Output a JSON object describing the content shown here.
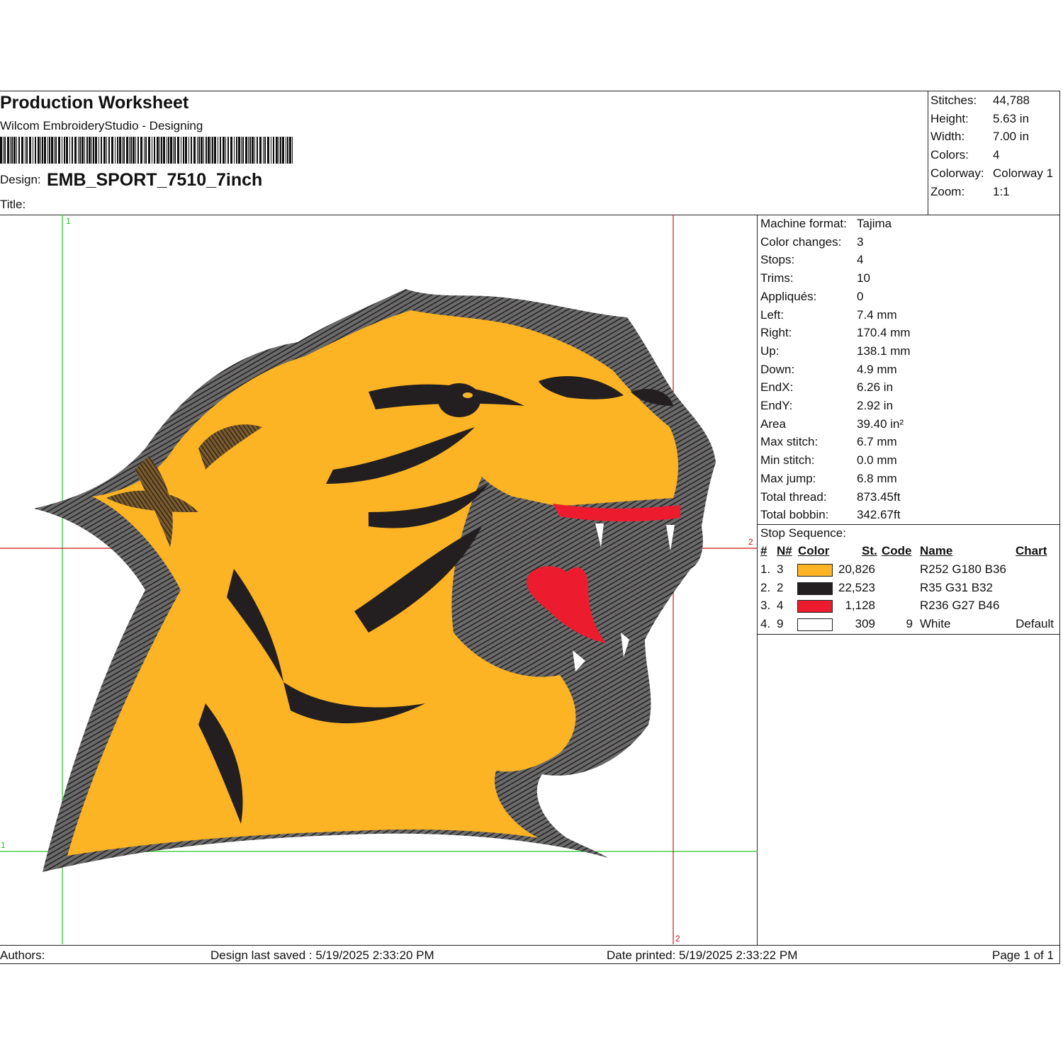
{
  "header": {
    "title": "Production Worksheet",
    "subtitle": "Wilcom EmbroideryStudio - Designing",
    "design_label": "Design:",
    "design_name": "EMB_SPORT_7510_7inch",
    "title_label": "Title:"
  },
  "summary": [
    {
      "label": "Stitches:",
      "value": "44,788"
    },
    {
      "label": "Height:",
      "value": "5.63 in"
    },
    {
      "label": "Width:",
      "value": "7.00 in"
    },
    {
      "label": "Colors:",
      "value": "4"
    },
    {
      "label": "Colorway:",
      "value": "Colorway 1"
    },
    {
      "label": "Zoom:",
      "value": "1:1"
    }
  ],
  "details": [
    {
      "label": "Machine format:",
      "value": "Tajima"
    },
    {
      "label": "Color changes:",
      "value": "3"
    },
    {
      "label": "Stops:",
      "value": "4"
    },
    {
      "label": "Trims:",
      "value": "10"
    },
    {
      "label": "Appliqués:",
      "value": "0"
    },
    {
      "label": "Left:",
      "value": "7.4 mm"
    },
    {
      "label": "Right:",
      "value": "170.4 mm"
    },
    {
      "label": "Up:",
      "value": "138.1 mm"
    },
    {
      "label": "Down:",
      "value": "4.9 mm"
    },
    {
      "label": "EndX:",
      "value": "6.26 in"
    },
    {
      "label": "EndY:",
      "value": "2.92 in"
    },
    {
      "label": "Area",
      "value": " 39.40 in²"
    },
    {
      "label": "Max stitch:",
      "value": "6.7 mm"
    },
    {
      "label": "Min stitch:",
      "value": "0.0 mm"
    },
    {
      "label": "Max jump:",
      "value": "6.8 mm"
    },
    {
      "label": "Total thread:",
      "value": "873.45ft"
    },
    {
      "label": "Total bobbin:",
      "value": "342.67ft"
    }
  ],
  "stop_sequence": {
    "label": "Stop Sequence:",
    "columns": {
      "num": "#",
      "n": "N#",
      "color": "Color",
      "st": "St.",
      "code": "Code",
      "name": "Name",
      "chart": "Chart"
    },
    "rows": [
      {
        "num": "1.",
        "n": "3",
        "swatch": "#FCB424",
        "st": "20,826",
        "code": "",
        "name": "R252 G180 B36",
        "chart": ""
      },
      {
        "num": "2.",
        "n": "2",
        "swatch": "#231F20",
        "st": "22,523",
        "code": "",
        "name": "R35 G31 B32",
        "chart": ""
      },
      {
        "num": "3.",
        "n": "4",
        "swatch": "#EC1B2E",
        "st": "1,128",
        "code": "",
        "name": "R236 G27 B46",
        "chart": ""
      },
      {
        "num": "4.",
        "n": "9",
        "swatch": "#FFFFFF",
        "st": "309",
        "code": "9",
        "name": "White",
        "chart": "Default"
      }
    ]
  },
  "canvas": {
    "guide_labels": {
      "top_left": "1",
      "right_mid": "2",
      "bottom_right": "2",
      "left_bottom": "1"
    },
    "colors": {
      "gold": "#FCB424",
      "dark": "#231F20",
      "red": "#EC1B2E",
      "white": "#FFFFFF",
      "guide_green": "#22C62A",
      "guide_red": "#D01818"
    }
  },
  "footer": {
    "authors": "Authors:",
    "saved": "Design last saved : 5/19/2025 2:33:20 PM",
    "printed": "Date printed: 5/19/2025 2:33:22 PM",
    "page": "Page 1 of 1"
  }
}
